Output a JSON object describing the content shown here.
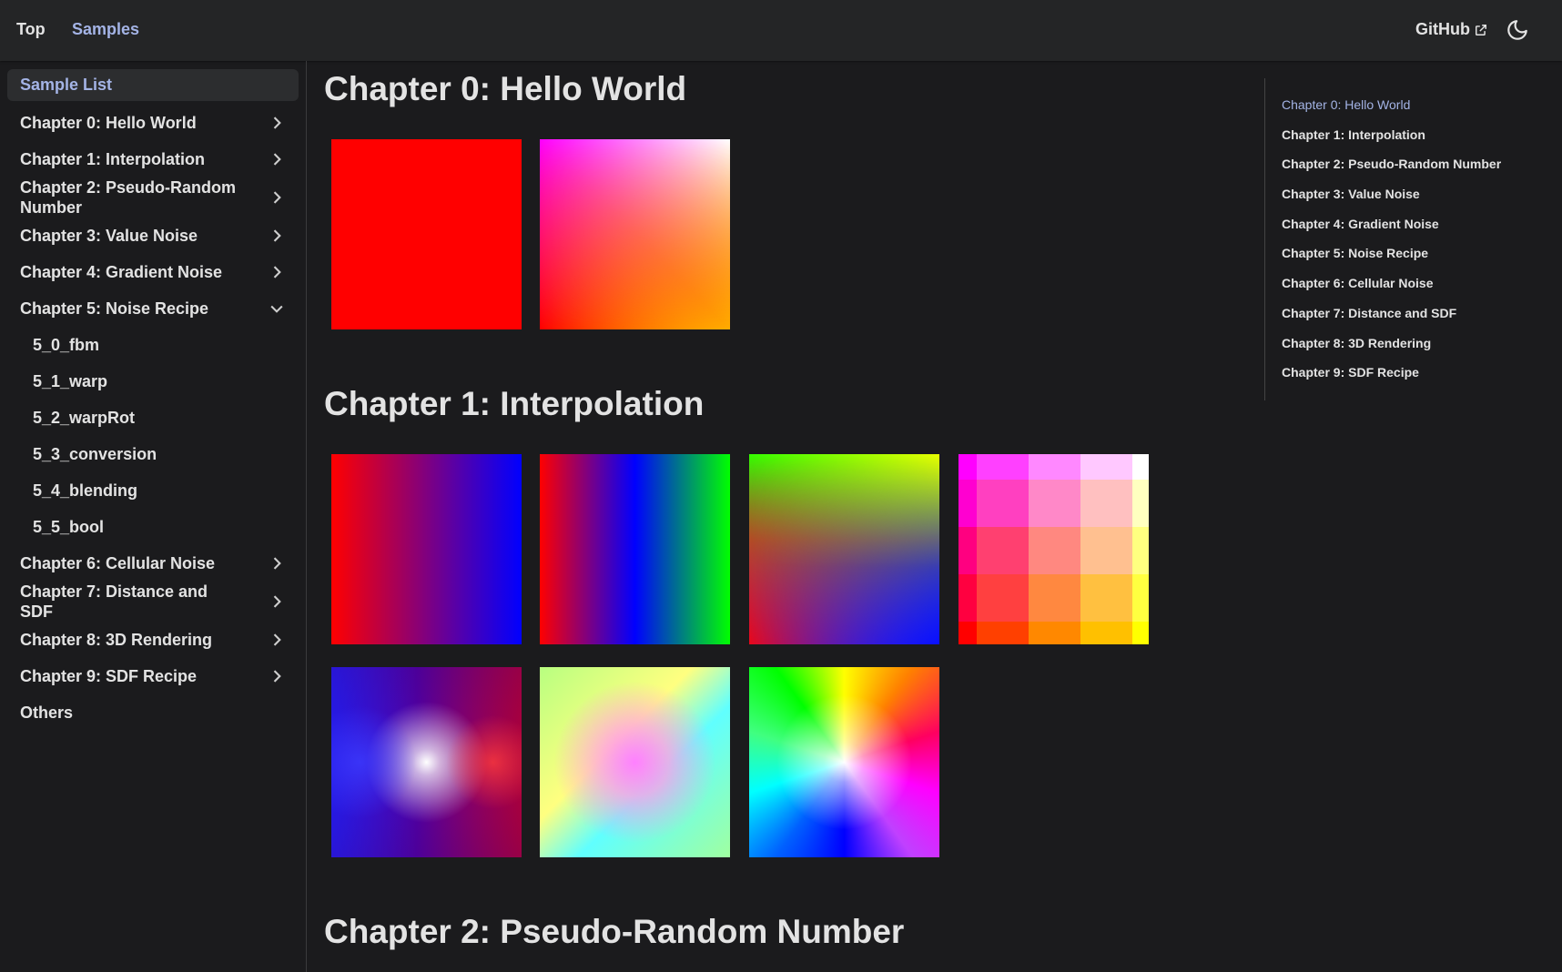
{
  "navbar": {
    "top_label": "Top",
    "samples_label": "Samples",
    "github_label": "GitHub"
  },
  "sidebar": {
    "header": "Sample List",
    "chapters": [
      {
        "label": "Chapter 0: Hello World"
      },
      {
        "label": "Chapter 1: Interpolation"
      },
      {
        "label": "Chapter 2: Pseudo-Random Number"
      },
      {
        "label": "Chapter 3: Value Noise"
      },
      {
        "label": "Chapter 4: Gradient Noise"
      },
      {
        "label": "Chapter 5: Noise Recipe"
      },
      {
        "label": "Chapter 6: Cellular Noise"
      },
      {
        "label": "Chapter 7: Distance and SDF"
      },
      {
        "label": "Chapter 8: 3D Rendering"
      },
      {
        "label": "Chapter 9: SDF Recipe"
      }
    ],
    "chapter5_items": [
      "5_0_fbm",
      "5_1_warp",
      "5_2_warpRot",
      "5_3_conversion",
      "5_4_blending",
      "5_5_bool"
    ],
    "others_label": "Others"
  },
  "main": {
    "sections": [
      {
        "title": "Chapter 0: Hello World"
      },
      {
        "title": "Chapter 1: Interpolation"
      },
      {
        "title": "Chapter 2: Pseudo-Random Number"
      }
    ]
  },
  "toc": {
    "items": [
      "Chapter 0: Hello World",
      "Chapter 1: Interpolation",
      "Chapter 2: Pseudo-Random Number",
      "Chapter 3: Value Noise",
      "Chapter 4: Gradient Noise",
      "Chapter 5: Noise Recipe",
      "Chapter 6: Cellular Noise",
      "Chapter 7: Distance and SDF",
      "Chapter 8: 3D Rendering",
      "Chapter 9: SDF Recipe"
    ]
  },
  "colors": {
    "accent": "#a4b4e6",
    "background": "#1b1b1d",
    "navbar": "#242526"
  },
  "icons": {
    "external_link": "external-link-icon",
    "theme": "moon-icon",
    "chevron_right": "chevron-right-icon",
    "chevron_down": "chevron-down-icon"
  }
}
